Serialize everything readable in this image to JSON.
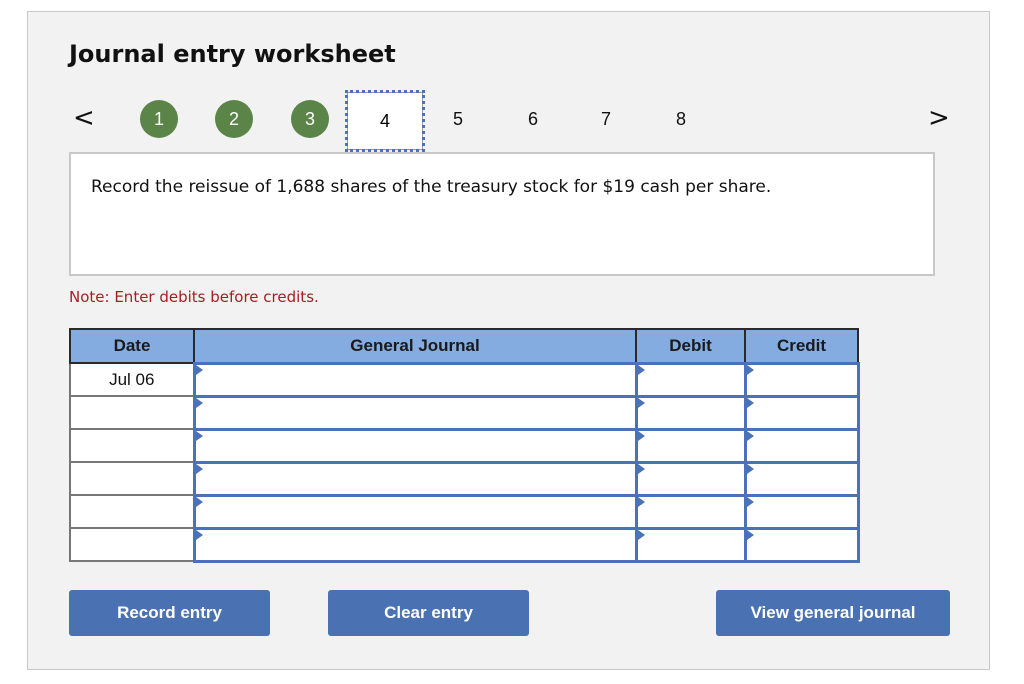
{
  "worksheet": {
    "title": "Journal entry worksheet",
    "nav": {
      "prev_icon": "chevron-left-icon",
      "next_icon": "chevron-right-icon",
      "prev_glyph": "<",
      "next_glyph": ">",
      "steps": [
        {
          "label": "1",
          "state": "completed"
        },
        {
          "label": "2",
          "state": "completed"
        },
        {
          "label": "3",
          "state": "completed"
        },
        {
          "label": "4",
          "state": "current"
        },
        {
          "label": "5",
          "state": "pending"
        },
        {
          "label": "6",
          "state": "pending"
        },
        {
          "label": "7",
          "state": "pending"
        },
        {
          "label": "8",
          "state": "pending"
        }
      ]
    },
    "question": "Record the reissue of 1,688 shares of the treasury stock for $19 cash per share.",
    "note": "Note: Enter debits before credits.",
    "table": {
      "headers": {
        "date": "Date",
        "journal": "General Journal",
        "debit": "Debit",
        "credit": "Credit"
      },
      "rows": [
        {
          "date": "Jul 06",
          "account": "",
          "debit": "",
          "credit": ""
        },
        {
          "date": "",
          "account": "",
          "debit": "",
          "credit": ""
        },
        {
          "date": "",
          "account": "",
          "debit": "",
          "credit": ""
        },
        {
          "date": "",
          "account": "",
          "debit": "",
          "credit": ""
        },
        {
          "date": "",
          "account": "",
          "debit": "",
          "credit": ""
        },
        {
          "date": "",
          "account": "",
          "debit": "",
          "credit": ""
        }
      ]
    },
    "buttons": {
      "record": "Record entry",
      "clear": "Clear entry",
      "view": "View general journal"
    },
    "colors": {
      "completed_step": "#5a8448",
      "header_bg": "#85ace0",
      "button_bg": "#4a72b2",
      "note_text": "#a32020"
    }
  }
}
